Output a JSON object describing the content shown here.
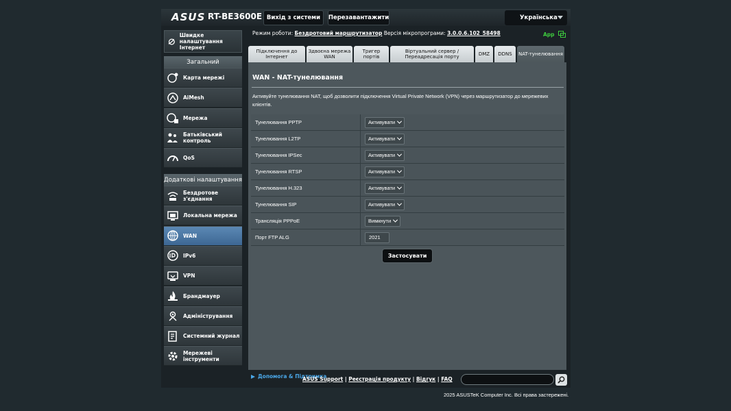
{
  "header": {
    "brand": "ASUS",
    "model": "RT-BE3600E",
    "logout_label": "Вихід з системи",
    "reboot_label": "Перезавантажити",
    "language": "Українська"
  },
  "info": {
    "mode_prefix": "Режим роботи:",
    "mode_value": "Бездротовий маршрутизатор",
    "firmware_prefix": "Версія мікропрограми:",
    "firmware_value": "3.0.0.6.102_58498",
    "app_label": "App"
  },
  "sidebar": {
    "quick_setup": "Швидке налаштування Інтернет",
    "general_title": "Загальний",
    "general_items": [
      {
        "label": "Карта мережі",
        "icon": "globe-map-icon"
      },
      {
        "label": "AiMesh",
        "icon": "mesh-icon"
      },
      {
        "label": "Мережа",
        "icon": "network-icon"
      },
      {
        "label": "Батьківський контроль",
        "icon": "parental-icon"
      },
      {
        "label": "QoS",
        "icon": "gauge-icon"
      }
    ],
    "advanced_title": "Додаткові налаштування",
    "advanced_items": [
      {
        "label": "Бездротове з'єднання",
        "icon": "wifi-icon"
      },
      {
        "label": "Локальна мережа",
        "icon": "lan-icon"
      },
      {
        "label": "WAN",
        "icon": "wan-globe-icon",
        "active": true
      },
      {
        "label": "IPv6",
        "icon": "ipv6-icon"
      },
      {
        "label": "VPN",
        "icon": "vpn-icon"
      },
      {
        "label": "Брандмауер",
        "icon": "firewall-icon"
      },
      {
        "label": "Адміністрування",
        "icon": "admin-icon"
      },
      {
        "label": "Системний журнал",
        "icon": "log-icon"
      },
      {
        "label": "Мережеві інструменти",
        "icon": "tools-icon"
      }
    ]
  },
  "tabs": [
    {
      "label": "Підключення до Інтернет"
    },
    {
      "label": "Здвоєна мережа WAN"
    },
    {
      "label": "Тригер портів"
    },
    {
      "label": "Віртуальний сервер / Переадресація порту"
    },
    {
      "label": "DMZ"
    },
    {
      "label": "DDNS"
    },
    {
      "label": "NAT-тунелювання",
      "active": true
    }
  ],
  "page": {
    "title": "WAN - NAT-тунелювання",
    "description": "Активуйте тунелювання NAT, щоб дозволити підключення Virtual Private Network (VPN) через маршрутизатор до мережевих клієнтів.",
    "rows": [
      {
        "label": "Тунелювання PPTP",
        "value": "Активувати",
        "type": "select"
      },
      {
        "label": "Тунелювання L2TP",
        "value": "Активувати",
        "type": "select"
      },
      {
        "label": "Тунелювання IPSec",
        "value": "Активувати",
        "type": "select"
      },
      {
        "label": "Тунелювання RTSP",
        "value": "Активувати",
        "type": "select"
      },
      {
        "label": "Тунелювання H.323",
        "value": "Активувати",
        "type": "select"
      },
      {
        "label": "Тунелювання SIP",
        "value": "Активувати",
        "type": "select"
      },
      {
        "label": "Трансляція PPPoE",
        "value": "Вимкнути",
        "type": "select"
      },
      {
        "label": "Порт FTP ALG",
        "value": "2021",
        "type": "input"
      }
    ],
    "apply_label": "Застосувати"
  },
  "footer": {
    "help_label": "Допомога & Підтримка",
    "links": [
      "ASUS Support",
      "Реєстрація продукту",
      "Відгук",
      "FAQ"
    ],
    "copyright": "2025 ASUSTeK Computer Inc. Всі права застережені."
  },
  "colors": {
    "accent_active": "#4f7eac",
    "app_green": "#3ecc3e",
    "help_blue": "#4aa7e8"
  }
}
